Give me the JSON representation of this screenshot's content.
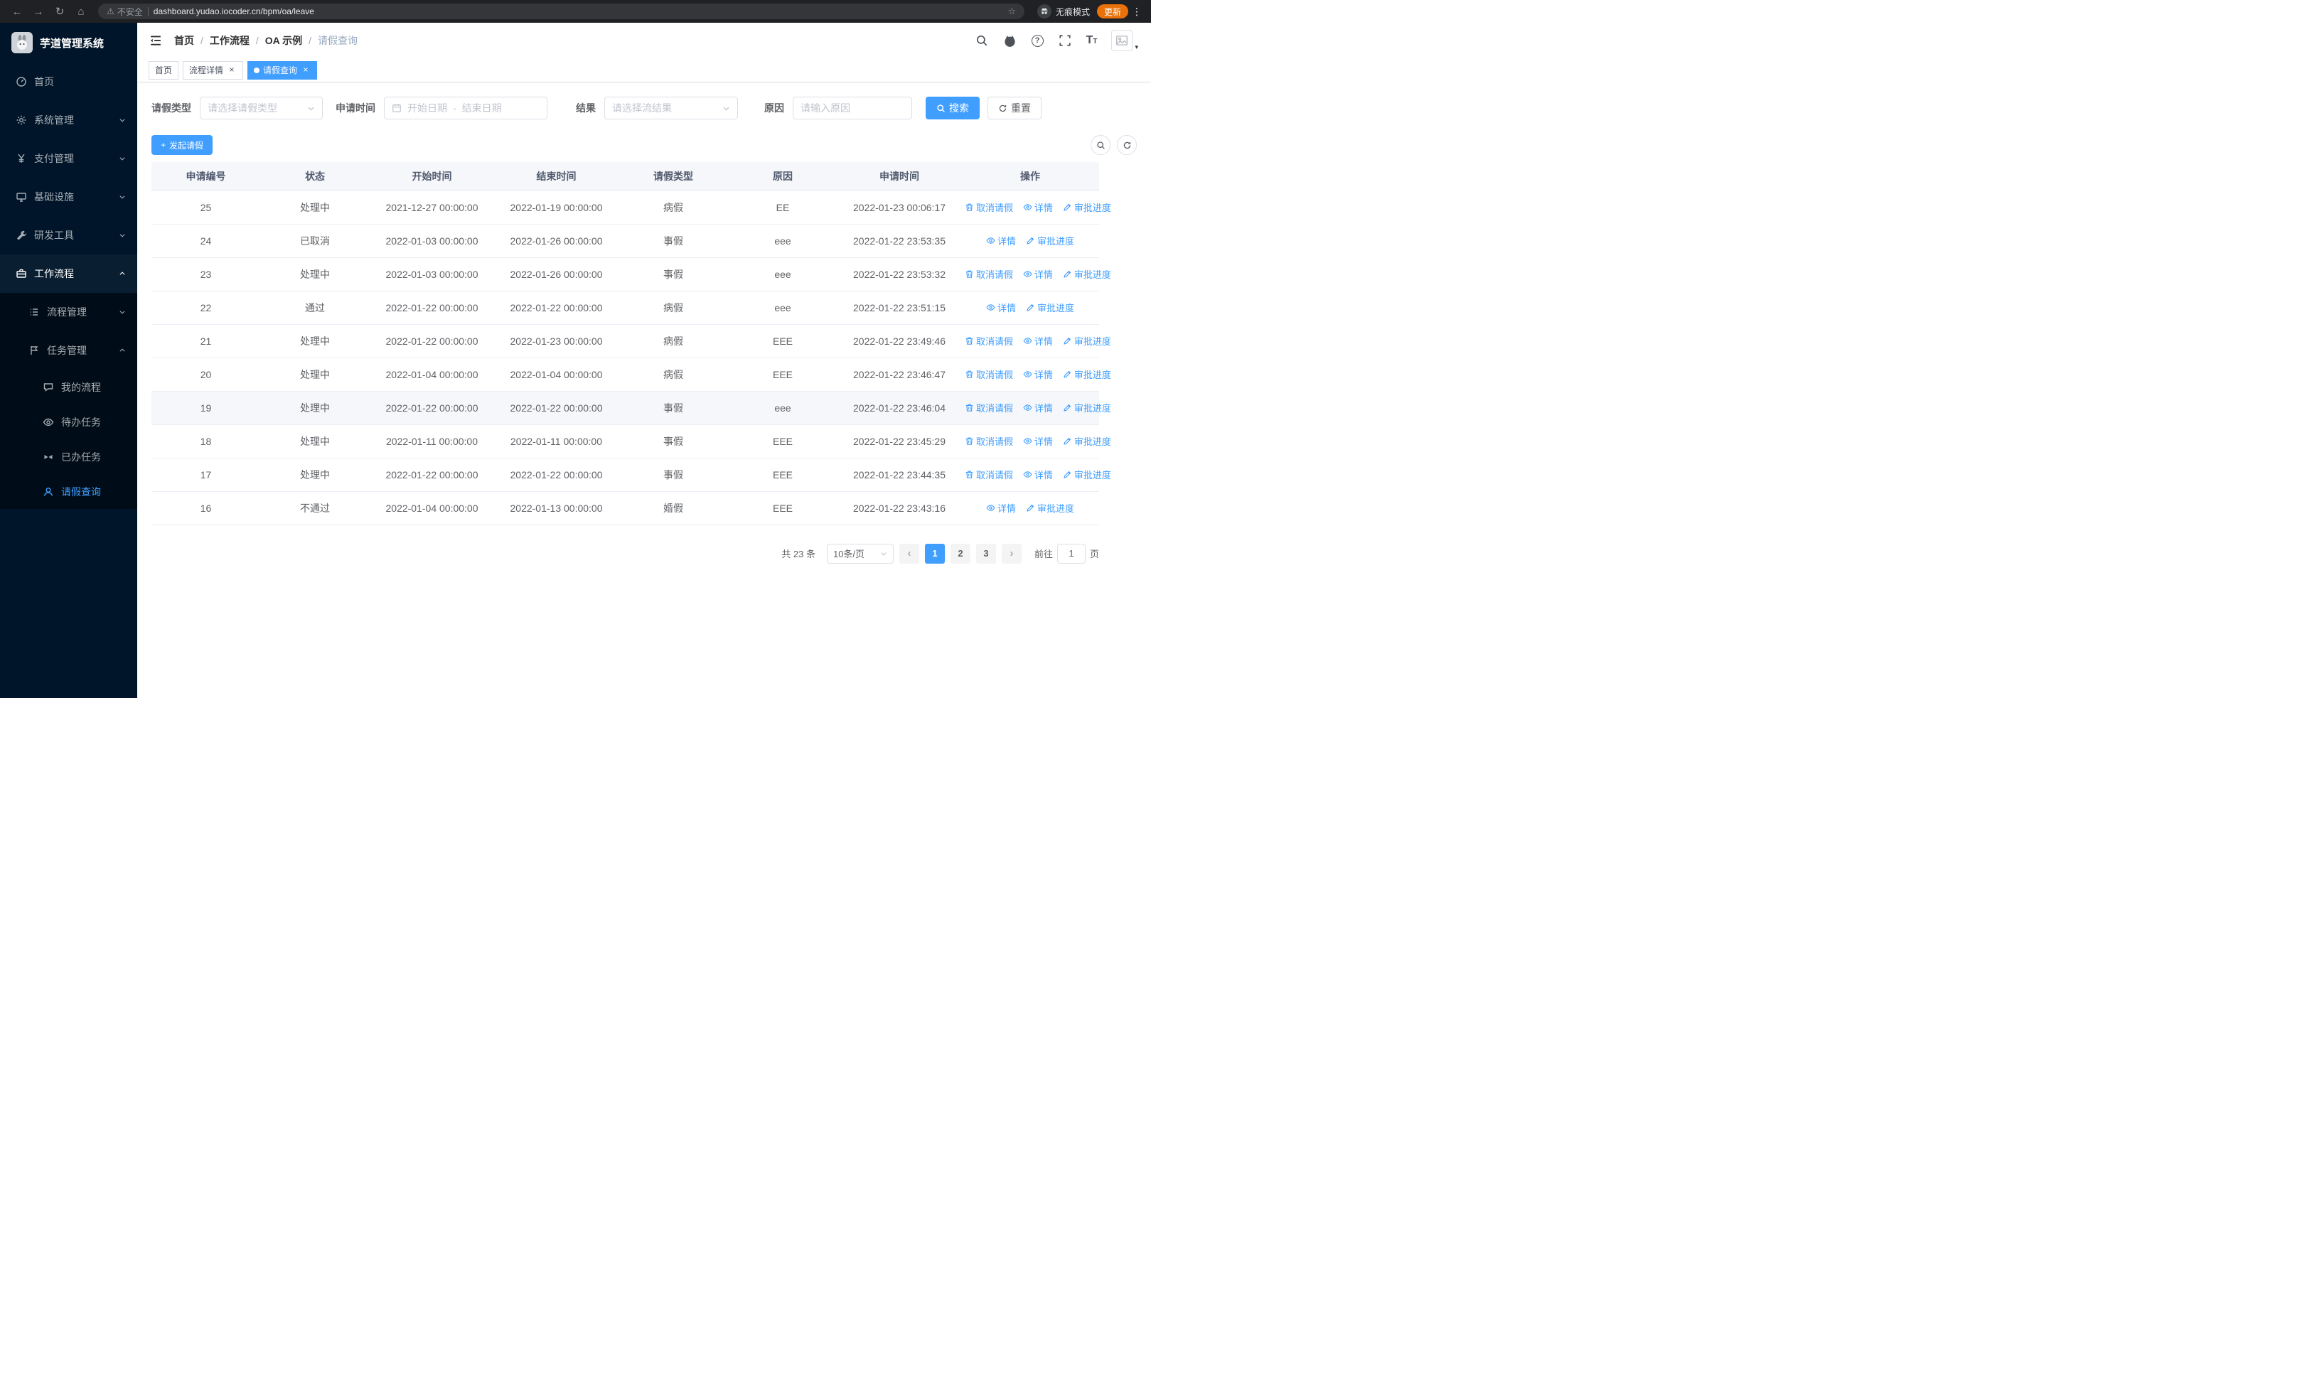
{
  "colors": {
    "accent": "#409eff",
    "sidebar_bg": "#001529",
    "submenu_bg": "#000c17",
    "active_tab_bg": "#409eff",
    "update_pill": "#e8710a",
    "table_header_bg": "#f5f7fa"
  },
  "browser": {
    "back": "←",
    "forward": "→",
    "reload": "↻",
    "home": "⌂",
    "warning_glyph": "⚠",
    "security_warning": "不安全",
    "url": "dashboard.yudao.iocoder.cn/bpm/oa/leave",
    "star": "☆",
    "incognito_label": "无痕模式",
    "update_label": "更新",
    "menu_glyph": "⋮"
  },
  "sidebar": {
    "logo_title": "芋道管理系统",
    "items": [
      {
        "label": "首页"
      },
      {
        "label": "系统管理"
      },
      {
        "label": "支付管理"
      },
      {
        "label": "基础设施"
      },
      {
        "label": "研发工具"
      },
      {
        "label": "工作流程"
      }
    ],
    "workflow_children": [
      {
        "label": "流程管理"
      },
      {
        "label": "任务管理"
      }
    ],
    "task_children": [
      {
        "label": "我的流程"
      },
      {
        "label": "待办任务"
      },
      {
        "label": "已办任务"
      },
      {
        "label": "请假查询"
      }
    ]
  },
  "header": {
    "breadcrumb": [
      "首页",
      "工作流程",
      "OA 示例",
      "请假查询"
    ],
    "separator": "/",
    "question_glyph": "?",
    "font_glyph_big": "T",
    "font_glyph_small": "T",
    "avatar_caret": "▾"
  },
  "tabs": [
    {
      "label": "首页"
    },
    {
      "label": "流程详情",
      "close": "×"
    },
    {
      "label": "请假查询",
      "close": "×"
    }
  ],
  "filters": {
    "leave_type_label": "请假类型",
    "leave_type_placeholder": "请选择请假类型",
    "apply_time_label": "申请时间",
    "start_date_placeholder": "开始日期",
    "range_separator": "-",
    "end_date_placeholder": "结束日期",
    "result_label": "结果",
    "result_placeholder": "请选择流结果",
    "reason_label": "原因",
    "reason_placeholder": "请输入原因",
    "search_button": "搜索",
    "reset_button": "重置"
  },
  "toolbar": {
    "create_button": "发起请假",
    "plus_glyph": "+"
  },
  "table": {
    "columns": [
      "申请编号",
      "状态",
      "开始时间",
      "结束时间",
      "请假类型",
      "原因",
      "申请时间",
      "操作"
    ],
    "actions": {
      "cancel": "取消请假",
      "detail": "详情",
      "progress": "审批进度"
    },
    "rows": [
      {
        "id": "25",
        "status": "处理中",
        "start": "2021-12-27 00:00:00",
        "end": "2022-01-19 00:00:00",
        "type": "病假",
        "reason": "EE",
        "apply_time": "2022-01-23 00:06:17",
        "can_cancel": true,
        "highlighted": false
      },
      {
        "id": "24",
        "status": "已取消",
        "start": "2022-01-03 00:00:00",
        "end": "2022-01-26 00:00:00",
        "type": "事假",
        "reason": "eee",
        "apply_time": "2022-01-22 23:53:35",
        "can_cancel": false,
        "highlighted": false
      },
      {
        "id": "23",
        "status": "处理中",
        "start": "2022-01-03 00:00:00",
        "end": "2022-01-26 00:00:00",
        "type": "事假",
        "reason": "eee",
        "apply_time": "2022-01-22 23:53:32",
        "can_cancel": true,
        "highlighted": false
      },
      {
        "id": "22",
        "status": "通过",
        "start": "2022-01-22 00:00:00",
        "end": "2022-01-22 00:00:00",
        "type": "病假",
        "reason": "eee",
        "apply_time": "2022-01-22 23:51:15",
        "can_cancel": false,
        "highlighted": false
      },
      {
        "id": "21",
        "status": "处理中",
        "start": "2022-01-22 00:00:00",
        "end": "2022-01-23 00:00:00",
        "type": "病假",
        "reason": "EEE",
        "apply_time": "2022-01-22 23:49:46",
        "can_cancel": true,
        "highlighted": false
      },
      {
        "id": "20",
        "status": "处理中",
        "start": "2022-01-04 00:00:00",
        "end": "2022-01-04 00:00:00",
        "type": "病假",
        "reason": "EEE",
        "apply_time": "2022-01-22 23:46:47",
        "can_cancel": true,
        "highlighted": false
      },
      {
        "id": "19",
        "status": "处理中",
        "start": "2022-01-22 00:00:00",
        "end": "2022-01-22 00:00:00",
        "type": "事假",
        "reason": "eee",
        "apply_time": "2022-01-22 23:46:04",
        "can_cancel": true,
        "highlighted": true
      },
      {
        "id": "18",
        "status": "处理中",
        "start": "2022-01-11 00:00:00",
        "end": "2022-01-11 00:00:00",
        "type": "事假",
        "reason": "EEE",
        "apply_time": "2022-01-22 23:45:29",
        "can_cancel": true,
        "highlighted": false
      },
      {
        "id": "17",
        "status": "处理中",
        "start": "2022-01-22 00:00:00",
        "end": "2022-01-22 00:00:00",
        "type": "事假",
        "reason": "EEE",
        "apply_time": "2022-01-22 23:44:35",
        "can_cancel": true,
        "highlighted": false
      },
      {
        "id": "16",
        "status": "不通过",
        "start": "2022-01-04 00:00:00",
        "end": "2022-01-13 00:00:00",
        "type": "婚假",
        "reason": "EEE",
        "apply_time": "2022-01-22 23:43:16",
        "can_cancel": false,
        "highlighted": false
      }
    ]
  },
  "pagination": {
    "total_text": "共 23 条",
    "page_size_label": "10条/页",
    "prev_glyph": "‹",
    "next_glyph": "›",
    "pages": [
      "1",
      "2",
      "3"
    ],
    "goto_label": "前往",
    "goto_value": "1",
    "goto_unit": "页"
  }
}
